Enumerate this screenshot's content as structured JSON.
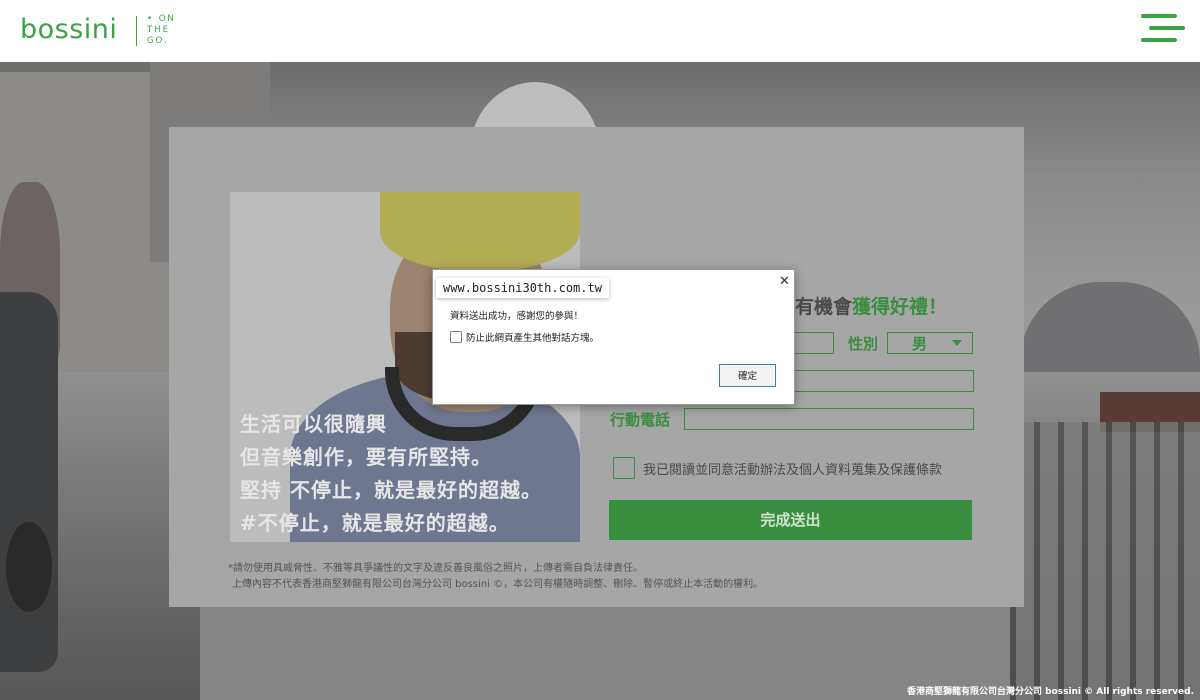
{
  "header": {
    "logo": "bossini",
    "tagline": [
      "• ON",
      "THE",
      "GO."
    ],
    "menu_icon": "hamburger-menu-icon"
  },
  "colors": {
    "brand_green": "#3aa346",
    "form_green": "#3a8e3f"
  },
  "promo": {
    "lines": [
      "生活可以很隨興",
      "但音樂創作，要有所堅持。",
      "堅持 不停止，就是最好的超越。",
      "#不停止，就是最好的超越。"
    ]
  },
  "form": {
    "title_prefix": "就有機會",
    "title_highlight": "獲得好禮！",
    "gender_label": "性別",
    "gender_value": "男",
    "phone_label": "行動電話",
    "agree_label": "我已閱讀並同意活動辦法及個人資料蒐集及保護條款",
    "submit_label": "完成送出"
  },
  "disclaimer": [
    "*請勿使用具威脅性、不雅等具爭議性的文字及違反善良風俗之照片，上傳者需自負法律責任。",
    "上傳內容不代表香港商堅獅龍有限公司台灣分公司 bossini ©，本公司有權隨時調整、刪除、暫停或終止本活動的權利。"
  ],
  "dialog": {
    "url": "www.bossini30th.com.tw",
    "message": "資料送出成功，感謝您的參與！",
    "checkbox_label": "防止此網頁產生其他對話方塊。",
    "ok_label": "確定",
    "close_icon": "close-icon"
  },
  "footer": "香港商堅獅龍有限公司台灣分公司 bossini © All rights reserved."
}
